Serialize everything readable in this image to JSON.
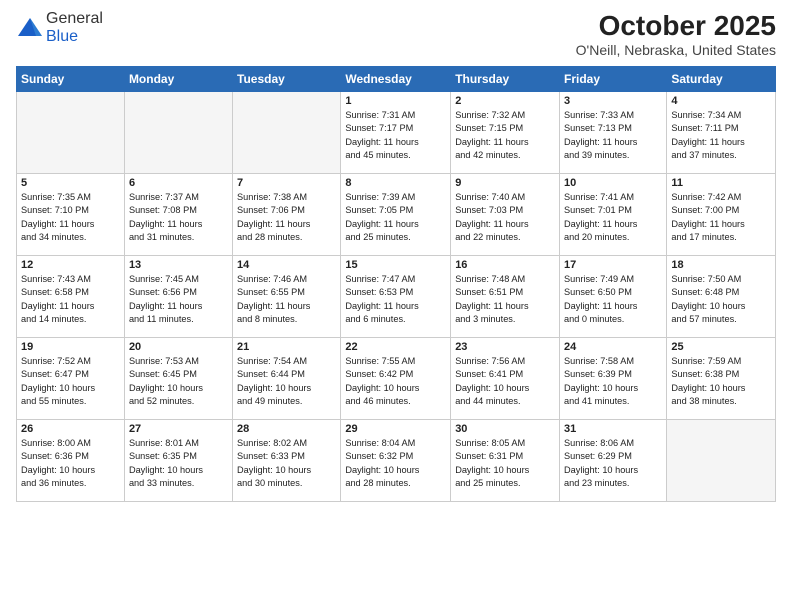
{
  "logo": {
    "line1": "General",
    "line2": "Blue"
  },
  "title": "October 2025",
  "subtitle": "O'Neill, Nebraska, United States",
  "days_of_week": [
    "Sunday",
    "Monday",
    "Tuesday",
    "Wednesday",
    "Thursday",
    "Friday",
    "Saturday"
  ],
  "weeks": [
    [
      {
        "day": "",
        "info": ""
      },
      {
        "day": "",
        "info": ""
      },
      {
        "day": "",
        "info": ""
      },
      {
        "day": "1",
        "info": "Sunrise: 7:31 AM\nSunset: 7:17 PM\nDaylight: 11 hours\nand 45 minutes."
      },
      {
        "day": "2",
        "info": "Sunrise: 7:32 AM\nSunset: 7:15 PM\nDaylight: 11 hours\nand 42 minutes."
      },
      {
        "day": "3",
        "info": "Sunrise: 7:33 AM\nSunset: 7:13 PM\nDaylight: 11 hours\nand 39 minutes."
      },
      {
        "day": "4",
        "info": "Sunrise: 7:34 AM\nSunset: 7:11 PM\nDaylight: 11 hours\nand 37 minutes."
      }
    ],
    [
      {
        "day": "5",
        "info": "Sunrise: 7:35 AM\nSunset: 7:10 PM\nDaylight: 11 hours\nand 34 minutes."
      },
      {
        "day": "6",
        "info": "Sunrise: 7:37 AM\nSunset: 7:08 PM\nDaylight: 11 hours\nand 31 minutes."
      },
      {
        "day": "7",
        "info": "Sunrise: 7:38 AM\nSunset: 7:06 PM\nDaylight: 11 hours\nand 28 minutes."
      },
      {
        "day": "8",
        "info": "Sunrise: 7:39 AM\nSunset: 7:05 PM\nDaylight: 11 hours\nand 25 minutes."
      },
      {
        "day": "9",
        "info": "Sunrise: 7:40 AM\nSunset: 7:03 PM\nDaylight: 11 hours\nand 22 minutes."
      },
      {
        "day": "10",
        "info": "Sunrise: 7:41 AM\nSunset: 7:01 PM\nDaylight: 11 hours\nand 20 minutes."
      },
      {
        "day": "11",
        "info": "Sunrise: 7:42 AM\nSunset: 7:00 PM\nDaylight: 11 hours\nand 17 minutes."
      }
    ],
    [
      {
        "day": "12",
        "info": "Sunrise: 7:43 AM\nSunset: 6:58 PM\nDaylight: 11 hours\nand 14 minutes."
      },
      {
        "day": "13",
        "info": "Sunrise: 7:45 AM\nSunset: 6:56 PM\nDaylight: 11 hours\nand 11 minutes."
      },
      {
        "day": "14",
        "info": "Sunrise: 7:46 AM\nSunset: 6:55 PM\nDaylight: 11 hours\nand 8 minutes."
      },
      {
        "day": "15",
        "info": "Sunrise: 7:47 AM\nSunset: 6:53 PM\nDaylight: 11 hours\nand 6 minutes."
      },
      {
        "day": "16",
        "info": "Sunrise: 7:48 AM\nSunset: 6:51 PM\nDaylight: 11 hours\nand 3 minutes."
      },
      {
        "day": "17",
        "info": "Sunrise: 7:49 AM\nSunset: 6:50 PM\nDaylight: 11 hours\nand 0 minutes."
      },
      {
        "day": "18",
        "info": "Sunrise: 7:50 AM\nSunset: 6:48 PM\nDaylight: 10 hours\nand 57 minutes."
      }
    ],
    [
      {
        "day": "19",
        "info": "Sunrise: 7:52 AM\nSunset: 6:47 PM\nDaylight: 10 hours\nand 55 minutes."
      },
      {
        "day": "20",
        "info": "Sunrise: 7:53 AM\nSunset: 6:45 PM\nDaylight: 10 hours\nand 52 minutes."
      },
      {
        "day": "21",
        "info": "Sunrise: 7:54 AM\nSunset: 6:44 PM\nDaylight: 10 hours\nand 49 minutes."
      },
      {
        "day": "22",
        "info": "Sunrise: 7:55 AM\nSunset: 6:42 PM\nDaylight: 10 hours\nand 46 minutes."
      },
      {
        "day": "23",
        "info": "Sunrise: 7:56 AM\nSunset: 6:41 PM\nDaylight: 10 hours\nand 44 minutes."
      },
      {
        "day": "24",
        "info": "Sunrise: 7:58 AM\nSunset: 6:39 PM\nDaylight: 10 hours\nand 41 minutes."
      },
      {
        "day": "25",
        "info": "Sunrise: 7:59 AM\nSunset: 6:38 PM\nDaylight: 10 hours\nand 38 minutes."
      }
    ],
    [
      {
        "day": "26",
        "info": "Sunrise: 8:00 AM\nSunset: 6:36 PM\nDaylight: 10 hours\nand 36 minutes."
      },
      {
        "day": "27",
        "info": "Sunrise: 8:01 AM\nSunset: 6:35 PM\nDaylight: 10 hours\nand 33 minutes."
      },
      {
        "day": "28",
        "info": "Sunrise: 8:02 AM\nSunset: 6:33 PM\nDaylight: 10 hours\nand 30 minutes."
      },
      {
        "day": "29",
        "info": "Sunrise: 8:04 AM\nSunset: 6:32 PM\nDaylight: 10 hours\nand 28 minutes."
      },
      {
        "day": "30",
        "info": "Sunrise: 8:05 AM\nSunset: 6:31 PM\nDaylight: 10 hours\nand 25 minutes."
      },
      {
        "day": "31",
        "info": "Sunrise: 8:06 AM\nSunset: 6:29 PM\nDaylight: 10 hours\nand 23 minutes."
      },
      {
        "day": "",
        "info": ""
      }
    ]
  ]
}
